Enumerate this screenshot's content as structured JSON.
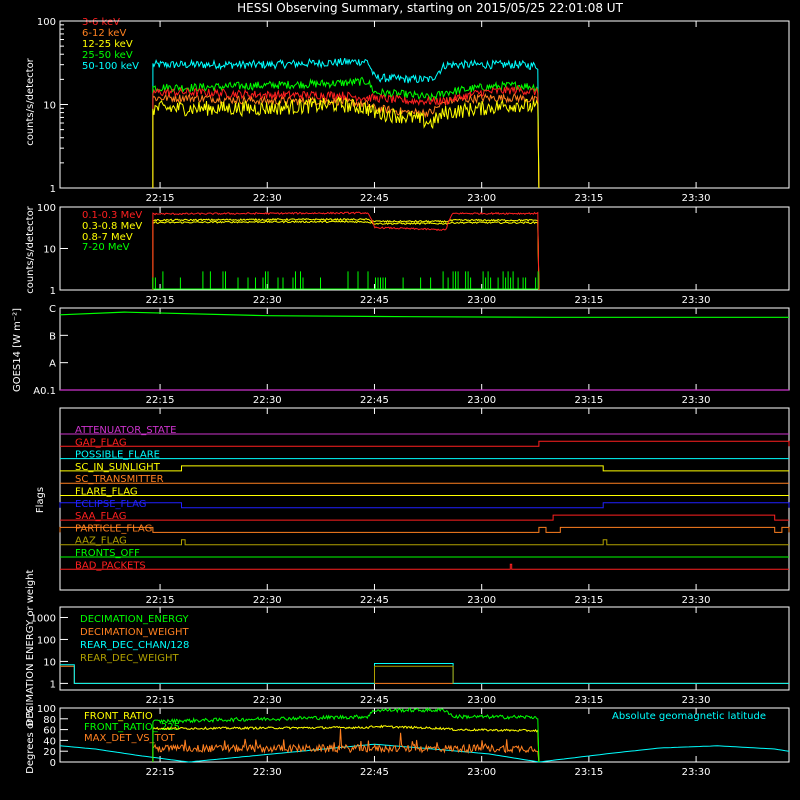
{
  "title": "HESSI Observing Summary, starting on 2015/05/25 22:01:08 UT",
  "colors": {
    "background": "#000000",
    "axes": "#ffffff",
    "red": "#ff2020",
    "orange": "#ff8020",
    "yellow": "#ffff00",
    "green": "#00ff00",
    "cyan": "#00ffff",
    "blue": "#2020ff",
    "magenta": "#cc33cc",
    "olive": "#b0a000"
  },
  "chart_data": [
    {
      "id": "hxr",
      "type": "line",
      "yscale": "log",
      "ylim": [
        1,
        100
      ],
      "yticks": [
        "1",
        "10",
        "100"
      ],
      "ylabel": "counts/s/detector",
      "xlim": [
        "22:01",
        "23:43"
      ],
      "xticks": [
        "22:15",
        "22:30",
        "22:45",
        "23:00",
        "23:15",
        "23:30"
      ],
      "data_start": "22:14",
      "data_end": "23:08",
      "series": [
        {
          "name": "3-6 keV",
          "color": "#ff2020",
          "x": [
            "22:14",
            "22:20",
            "22:30",
            "22:40",
            "22:44",
            "22:45",
            "22:50",
            "22:53",
            "22:55",
            "23:00",
            "23:05",
            "23:08"
          ],
          "y": [
            14,
            14,
            13,
            13,
            12,
            12,
            11,
            11,
            11,
            14,
            15,
            14
          ]
        },
        {
          "name": "6-12 keV",
          "color": "#ff8020",
          "x": [
            "22:14",
            "22:20",
            "22:30",
            "22:40",
            "22:44",
            "22:45",
            "22:50",
            "22:53",
            "22:55",
            "23:00",
            "23:05",
            "23:08"
          ],
          "y": [
            12,
            12,
            11,
            11,
            10,
            9,
            8,
            8,
            11,
            12,
            12,
            11
          ]
        },
        {
          "name": "12-25 keV",
          "color": "#ffff00",
          "x": [
            "22:14",
            "22:20",
            "22:30",
            "22:40",
            "22:44",
            "22:45",
            "22:50",
            "22:53",
            "22:55",
            "23:00",
            "23:05",
            "23:08"
          ],
          "y": [
            9,
            9,
            9,
            10,
            9,
            8,
            7,
            6,
            8,
            9,
            10,
            9
          ]
        },
        {
          "name": "25-50 keV",
          "color": "#00ff00",
          "x": [
            "22:14",
            "22:20",
            "22:30",
            "22:40",
            "22:44",
            "22:45",
            "22:50",
            "22:53",
            "22:55",
            "23:00",
            "23:05",
            "23:08"
          ],
          "y": [
            16,
            16,
            17,
            18,
            19,
            14,
            13,
            12,
            14,
            16,
            17,
            16
          ]
        },
        {
          "name": "50-100 keV",
          "color": "#00ffff",
          "x": [
            "22:14",
            "22:20",
            "22:30",
            "22:40",
            "22:44",
            "22:45",
            "22:50",
            "22:53",
            "22:55",
            "23:00",
            "23:05",
            "23:08"
          ],
          "y": [
            30,
            30,
            30,
            32,
            33,
            21,
            20,
            20,
            30,
            30,
            30,
            29
          ]
        }
      ]
    },
    {
      "id": "gamma",
      "type": "line",
      "yscale": "log",
      "ylim": [
        1,
        100
      ],
      "yticks": [
        "1",
        "10",
        "100"
      ],
      "ylabel": "counts/s/detector",
      "xticks": [
        "22:15",
        "22:30",
        "22:45",
        "23:00",
        "23:15",
        "23:30"
      ],
      "series": [
        {
          "name": "0.1-0.3 MeV",
          "color": "#ff2020",
          "x": [
            "22:14",
            "22:30",
            "22:44",
            "22:45",
            "22:55",
            "22:56",
            "23:08"
          ],
          "y": [
            68,
            70,
            72,
            32,
            28,
            70,
            70
          ]
        },
        {
          "name": "0.3-0.8 MeV",
          "color": "#ffff00",
          "x": [
            "22:14",
            "22:30",
            "22:44",
            "22:45",
            "22:55",
            "22:56",
            "23:08"
          ],
          "y": [
            48,
            50,
            50,
            45,
            45,
            48,
            48
          ]
        },
        {
          "name": "0.8-7 MeV",
          "color": "#ffff00",
          "x": [
            "22:14",
            "22:30",
            "22:44",
            "22:45",
            "22:55",
            "22:56",
            "23:08"
          ],
          "y": [
            42,
            44,
            44,
            40,
            40,
            42,
            42
          ]
        },
        {
          "name": "7-20 MeV",
          "color": "#00ff00",
          "x": [
            "22:14",
            "23:08"
          ],
          "y": [
            1,
            1
          ]
        }
      ]
    },
    {
      "id": "goes",
      "type": "line",
      "ylabel": "GOES14 [W m⁻²]",
      "yticks": [
        "A0.1",
        "A",
        "B",
        "C"
      ],
      "xticks": [
        "22:15",
        "22:30",
        "22:45",
        "23:00",
        "23:15",
        "23:30"
      ],
      "series": [
        {
          "name": "low",
          "color": "#cc33cc",
          "x": [
            "22:01",
            "23:43"
          ],
          "y": [
            0,
            0
          ]
        },
        {
          "name": "high",
          "color": "#00ff00",
          "x": [
            "22:01",
            "22:10",
            "22:30",
            "22:50",
            "23:10",
            "23:43"
          ],
          "y": [
            2.75,
            2.85,
            2.72,
            2.68,
            2.66,
            2.66
          ]
        }
      ]
    },
    {
      "id": "flags",
      "type": "line",
      "ylabel": "Flags",
      "xticks": [
        "22:15",
        "22:30",
        "22:45",
        "23:00",
        "23:15",
        "23:30"
      ],
      "flags": [
        {
          "name": "ATTENUATOR_STATE",
          "color": "#cc33cc",
          "on": []
        },
        {
          "name": "GAP_FLAG",
          "color": "#ff2020",
          "on": [
            [
              "23:08",
              "23:43"
            ]
          ]
        },
        {
          "name": "POSSIBLE_FLARE",
          "color": "#00ffff",
          "on": []
        },
        {
          "name": "SC_IN_SUNLIGHT",
          "color": "#ffff00",
          "on": [
            [
              "22:18",
              "23:17"
            ]
          ]
        },
        {
          "name": "SC_TRANSMITTER",
          "color": "#ff8020",
          "on": []
        },
        {
          "name": "FLARE_FLAG",
          "color": "#ffff00",
          "on": []
        },
        {
          "name": "ECLIPSE_FLAG",
          "color": "#2020ff",
          "on": [
            [
              "22:01",
              "22:18"
            ],
            [
              "23:17",
              "23:43"
            ]
          ]
        },
        {
          "name": "SAA_FLAG",
          "color": "#ff2020",
          "on": [
            [
              "23:10",
              "23:41"
            ]
          ]
        },
        {
          "name": "PARTICLE_FLAG",
          "color": "#ff8020",
          "on": [
            [
              "22:01",
              "22:14"
            ],
            [
              "23:08",
              "23:09"
            ],
            [
              "23:11",
              "23:41"
            ],
            [
              "23:42",
              "23:43"
            ]
          ]
        },
        {
          "name": "AAZ_FLAG",
          "color": "#b0a000",
          "on": [
            [
              "22:18",
              "22:18.5"
            ],
            [
              "23:17",
              "23:17.5"
            ]
          ]
        },
        {
          "name": "FRONTS_OFF",
          "color": "#00ff00",
          "on": []
        },
        {
          "name": "BAD_PACKETS",
          "color": "#ff2020",
          "on": [
            [
              "23:04",
              "23:04.2"
            ]
          ]
        }
      ]
    },
    {
      "id": "decim",
      "type": "line",
      "yscale": "log",
      "ylim": [
        0.5,
        3000
      ],
      "yticks": [
        "1",
        "10",
        "100",
        "1000"
      ],
      "ylabel": "DECIMATION ENERGY or weight",
      "xticks": [
        "22:15",
        "22:30",
        "22:45",
        "23:00",
        "23:15",
        "23:30"
      ],
      "series": [
        {
          "name": "DECIMATION_ENERGY",
          "color": "#00ff00",
          "x": [],
          "y": []
        },
        {
          "name": "DECIMATION_WEIGHT",
          "color": "#ff8020",
          "x": [
            "22:01",
            "22:03",
            "22:03",
            "23:43"
          ],
          "y": [
            6,
            6,
            1,
            1
          ]
        },
        {
          "name": "REAR_DEC_CHAN/128",
          "color": "#00ffff",
          "x": [
            "22:01",
            "22:03",
            "22:03",
            "22:45",
            "22:45",
            "22:56",
            "22:56",
            "23:43"
          ],
          "y": [
            7,
            7,
            1,
            1,
            8,
            8,
            1,
            1
          ]
        },
        {
          "name": "REAR_DEC_WEIGHT",
          "color": "#b0a000",
          "x": [
            "22:45",
            "22:45",
            "22:56",
            "22:56"
          ],
          "y": [
            1,
            6,
            6,
            1
          ]
        }
      ]
    },
    {
      "id": "ratios",
      "type": "line",
      "ylim": [
        0,
        100
      ],
      "yticks": [
        "0",
        "20",
        "40",
        "60",
        "80",
        "100"
      ],
      "ylabel": "Degrees or %",
      "xticks": [
        "22:15",
        "22:30",
        "22:45",
        "23:00",
        "23:15",
        "23:30"
      ],
      "annotation": "Absolute geomagnetic latitude",
      "series": [
        {
          "name": "FRONT_RATIO",
          "color": "#ffff00",
          "x": [
            "22:14",
            "22:44",
            "22:45",
            "22:55",
            "22:56",
            "23:08"
          ],
          "y": [
            62,
            64,
            66,
            62,
            60,
            58
          ]
        },
        {
          "name": "FRONT_RATIO_ 225",
          "color": "#00ff00",
          "x": [
            "22:14",
            "22:30",
            "22:44",
            "22:45",
            "22:55",
            "22:56",
            "23:08"
          ],
          "y": [
            75,
            80,
            84,
            96,
            96,
            84,
            83
          ]
        },
        {
          "name": "MAX_DET_VS_TOT",
          "color": "#ff8020",
          "x": [
            "22:14",
            "23:08"
          ],
          "y": [
            25,
            25
          ]
        },
        {
          "name": "geomagnetic",
          "color": "#00ffff",
          "x": [
            "22:01",
            "22:06",
            "22:12",
            "22:19",
            "22:30",
            "22:45",
            "22:55",
            "23:01",
            "23:08",
            "23:18",
            "23:25",
            "23:33",
            "23:41",
            "23:43"
          ],
          "y": [
            30,
            24,
            12,
            0,
            14,
            33,
            22,
            15,
            0,
            16,
            26,
            30,
            24,
            20
          ]
        }
      ]
    }
  ]
}
